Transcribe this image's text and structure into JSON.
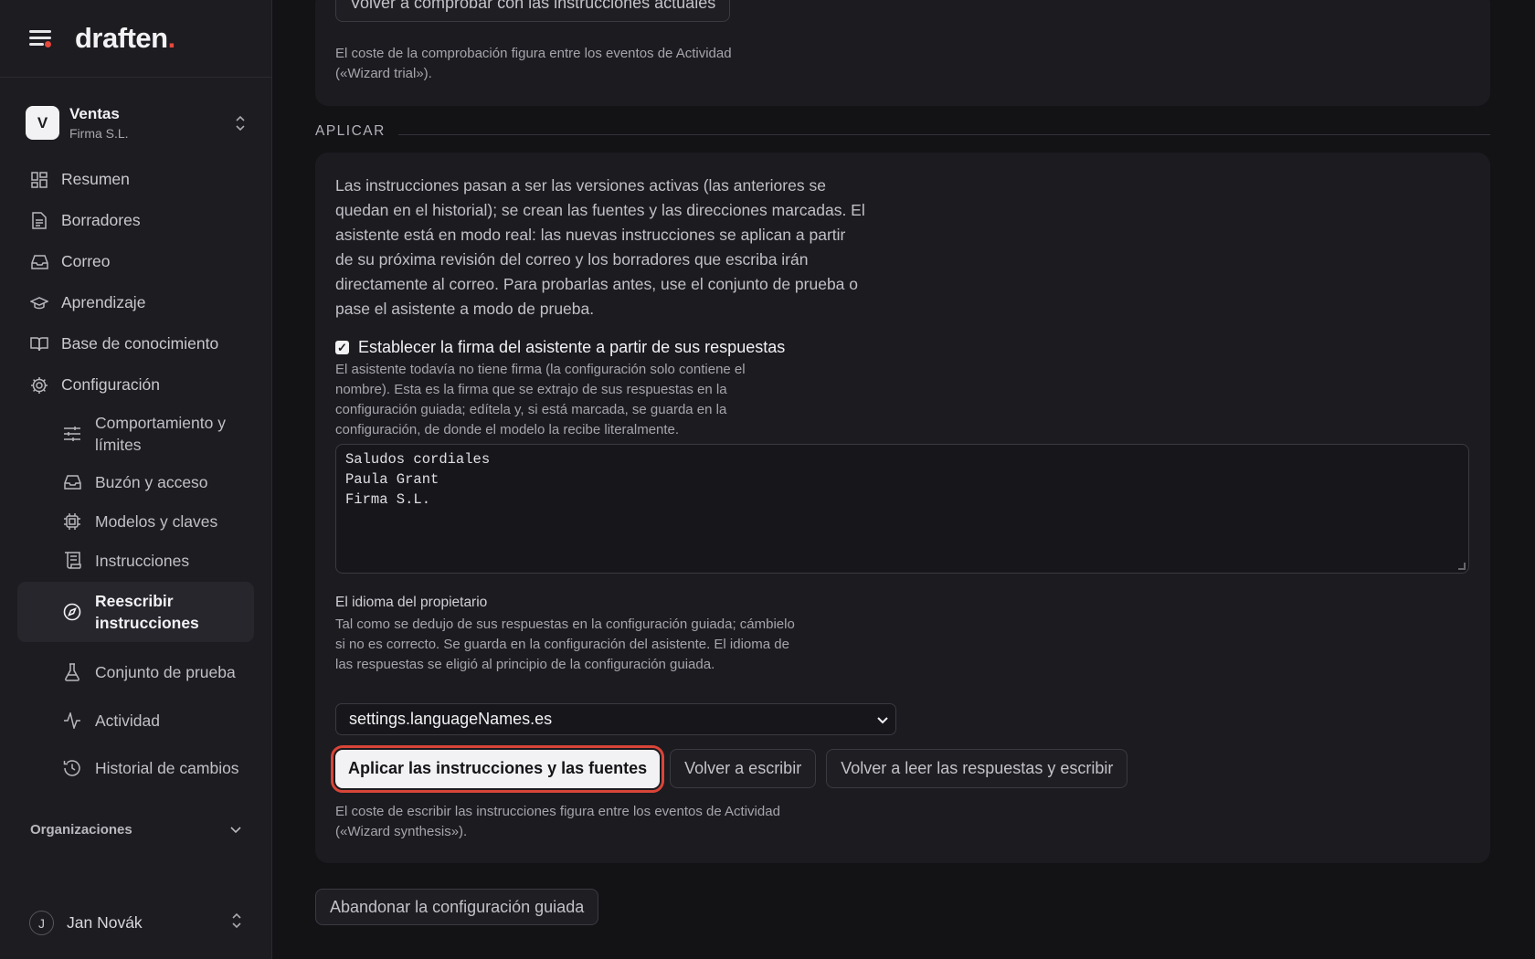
{
  "brand": {
    "name": "draften",
    "dot": "."
  },
  "workspace": {
    "initial": "V",
    "name": "Ventas",
    "org": "Firma S.L."
  },
  "nav": {
    "items": [
      {
        "label": "Resumen",
        "icon": "dashboard-icon"
      },
      {
        "label": "Borradores",
        "icon": "document-icon"
      },
      {
        "label": "Correo",
        "icon": "inbox-icon"
      },
      {
        "label": "Aprendizaje",
        "icon": "graduation-cap-icon"
      },
      {
        "label": "Base de conocimiento",
        "icon": "book-icon"
      },
      {
        "label": "Configuración",
        "icon": "gear-icon"
      }
    ],
    "sub_items": [
      {
        "label": "Comportamiento y límites",
        "icon": "sliders-icon"
      },
      {
        "label": "Buzón y acceso",
        "icon": "inbox-icon"
      },
      {
        "label": "Modelos y claves",
        "icon": "chip-icon"
      },
      {
        "label": "Instrucciones",
        "icon": "scroll-icon"
      },
      {
        "label": "Reescribir instrucciones",
        "icon": "compass-icon"
      },
      {
        "label": "Conjunto de prueba",
        "icon": "flask-icon"
      },
      {
        "label": "Actividad",
        "icon": "activity-icon"
      },
      {
        "label": "Historial de cambios",
        "icon": "history-icon"
      }
    ],
    "organizations_label": "Organizaciones"
  },
  "user": {
    "initial": "J",
    "name": "Jan Novák"
  },
  "check_section": {
    "recheck_button": "Volver a comprobar con las instrucciones actuales",
    "cost_note": "El coste de la comprobación figura entre los eventos de Actividad («Wizard trial»)."
  },
  "apply_section": {
    "label": "APLICAR",
    "intro": "Las instrucciones pasan a ser las versiones activas (las anteriores se quedan en el historial); se crean las fuentes y las direcciones marcadas. El asistente está en modo real: las nuevas instrucciones se aplican a partir de su próxima revisión del correo y los borradores que escriba irán directamente al correo. Para probarlas antes, use el conjunto de prueba o pase el asistente a modo de prueba.",
    "signature_checkbox_label": "Establecer la firma del asistente a partir de sus respuestas",
    "signature_checked": true,
    "signature_help": "El asistente todavía no tiene firma (la configuración solo contiene el nombre). Esta es la firma que se extrajo de sus respuestas en la configuración guiada; edítela y, si está marcada, se guarda en la configuración, de donde el modelo la recibe literalmente.",
    "signature_lines": [
      "Saludos cordiales",
      "Paula Grant",
      "Firma S.L."
    ],
    "language_label": "El idioma del propietario",
    "language_help": "Tal como se dedujo de sus respuestas en la configuración guiada; cámbielo si no es correcto. Se guarda en la configuración del asistente. El idioma de las respuestas se eligió al principio de la configuración guiada.",
    "language_selected": "settings.languageNames.es",
    "apply_button": "Aplicar las instrucciones y las fuentes",
    "rewrite_button": "Volver a escribir",
    "reread_button": "Volver a leer las respuestas y escribir",
    "cost_note": "El coste de escribir las instrucciones figura entre los eventos de Actividad («Wizard synthesis»)."
  },
  "abandon_button": "Abandonar la configuración guiada",
  "colors": {
    "accent": "#e5483c",
    "background": "#131316",
    "sidebar": "#1c1c21",
    "card": "#1b1b20"
  }
}
